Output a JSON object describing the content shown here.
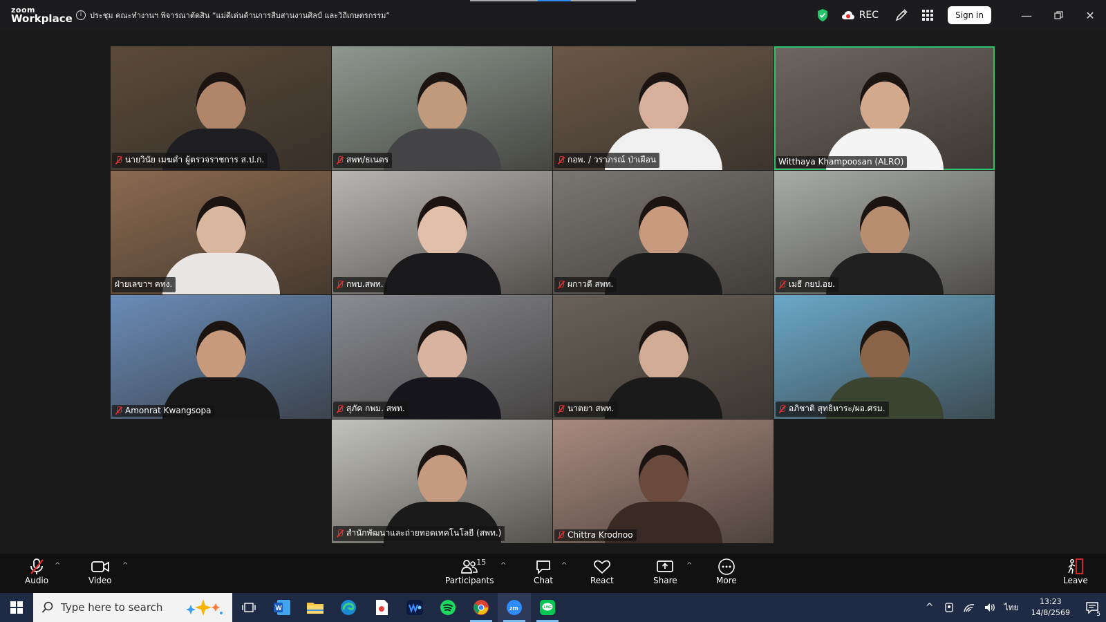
{
  "app": {
    "logo_line1": "zoom",
    "logo_line2": "Workplace"
  },
  "meeting": {
    "title": "ประชุม คณะทำงานฯ พิจารณาตัดสิน “แม่ดีเด่นด้านการสืบสานงานศิลป์ และวิถีเกษตรกรรม”"
  },
  "header": {
    "rec_label": "REC",
    "signin_label": "Sign in"
  },
  "participants": [
    {
      "name": "นายวินัย เมฆดำ ผู้ตรวจราชการ ส.ป.ก.",
      "muted": true,
      "bg": "#5a4a3a",
      "skin": "#b0856a",
      "shirt": "#1e1e22"
    },
    {
      "name": "สพท/ธเนตร",
      "muted": true,
      "bg": "#8d9890",
      "skin": "#c09a7c",
      "shirt": "#444446"
    },
    {
      "name": "กอพ. / วราภรณ์ ป่าเผือน",
      "muted": true,
      "bg": "#6a5848",
      "skin": "#d6b09a",
      "shirt": "#f0f0f0"
    },
    {
      "name": "Witthaya Khampoosan (ALRO)",
      "muted": false,
      "active": true,
      "bg": "#6e6660",
      "skin": "#d2a98c",
      "shirt": "#f4f4f4"
    },
    {
      "name": "ฝ่ายเลขาฯ คทง.",
      "muted": false,
      "bg": "#8a6a50",
      "skin": "#d9b79f",
      "shirt": "#eae6e4"
    },
    {
      "name": "กพบ.สพท.",
      "muted": true,
      "bg": "#b8b6b4",
      "skin": "#e2bfa8",
      "shirt": "#1a1a1c"
    },
    {
      "name": "ผกาวดี สพท.",
      "muted": true,
      "bg": "#7a7672",
      "skin": "#c99a7e",
      "shirt": "#1c1c1c"
    },
    {
      "name": "เมธี กยป.อย.",
      "muted": true,
      "bg": "#a8aca8",
      "skin": "#b98e70",
      "shirt": "#202020"
    },
    {
      "name": "Amonrat Kwangsopa",
      "muted": true,
      "bg": "#6a8cb8",
      "skin": "#c79a7c",
      "shirt": "#181818"
    },
    {
      "name": "สุภัค กพม. สพท.",
      "muted": true,
      "bg": "#8a8c92",
      "skin": "#d8b4a0",
      "shirt": "#16161c"
    },
    {
      "name": "นาตยา สพท.",
      "muted": true,
      "bg": "#6a6258",
      "skin": "#d0ac94",
      "shirt": "#1a1a1a"
    },
    {
      "name": "อภิชาติ สุทธิหาระ/ผอ.ศรม.",
      "muted": true,
      "bg": "#6aa8c8",
      "skin": "#8a6448",
      "shirt": "#3a4430"
    },
    {
      "name": "สำนักพัฒนาและถ่ายทอดเทคโนโลยี (สพท.)",
      "muted": true,
      "bg": "#c2c2bc",
      "skin": "#c69a7e",
      "shirt": "#1a1a1a"
    },
    {
      "name": "Chittra Krodnoo",
      "muted": true,
      "bg": "#a88a80",
      "skin": "#6a4a3c",
      "shirt": "#3a2a24"
    }
  ],
  "toolbar": {
    "audio_label": "Audio",
    "video_label": "Video",
    "participants_label": "Participants",
    "participants_count": "15",
    "chat_label": "Chat",
    "react_label": "React",
    "share_label": "Share",
    "more_label": "More",
    "leave_label": "Leave"
  },
  "taskbar": {
    "search_placeholder": "Type here to search",
    "lang": "ไทย",
    "time": "13:23",
    "date": "14/8/2569",
    "notifications": "5"
  },
  "colors": {
    "accent": "#2d8cff",
    "active_speaker": "#28c36c",
    "muted_red": "#e02d2d"
  }
}
